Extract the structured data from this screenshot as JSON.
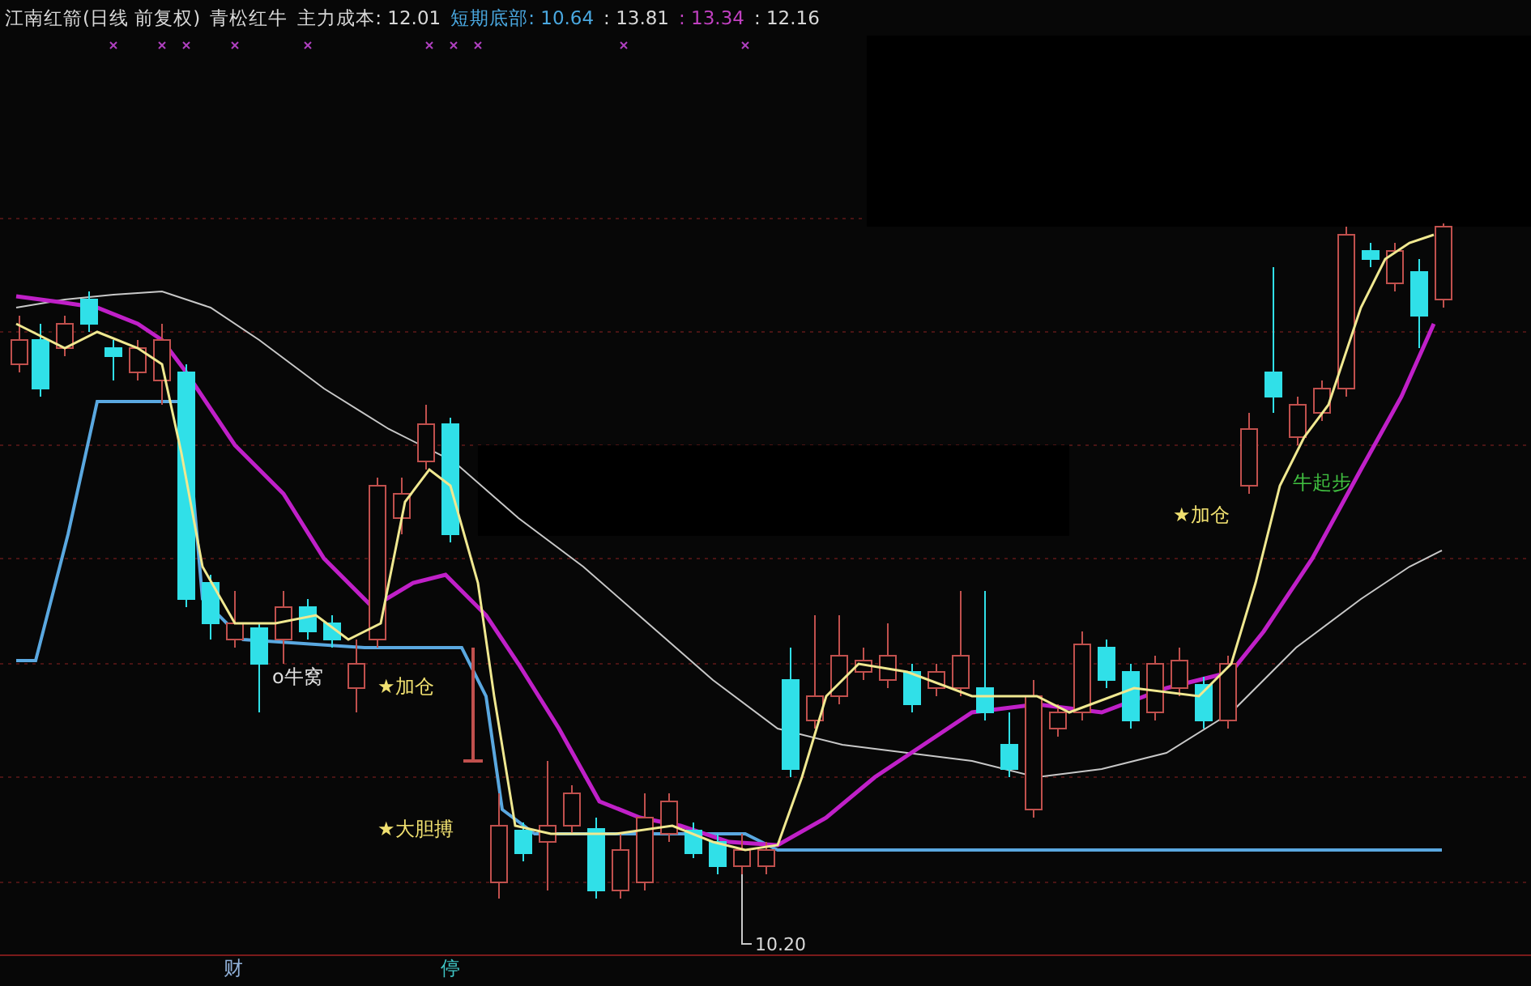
{
  "header": {
    "title": "江南红箭(日线 前复权)",
    "indicator": "青松红牛",
    "items": [
      {
        "text": "主力成本: 12.01",
        "color": "#d8d8d8"
      },
      {
        "text": "短期底部: 10.64",
        "color": "#4aa8e0"
      },
      {
        "text": ": 13.81",
        "color": "#d8d8d8"
      },
      {
        "text": ": 13.34",
        "color": "#c040c0"
      },
      {
        "text": ": 12.16",
        "color": "#d8d8d8"
      }
    ]
  },
  "chart": {
    "annotations": [
      {
        "text": "o牛窝",
        "color": "#e0e0e0"
      },
      {
        "text": "★加仓",
        "color": "#f0e070"
      },
      {
        "text": "★大胆搏",
        "color": "#f0e070"
      },
      {
        "text": "★加仓",
        "color": "#f0e070"
      },
      {
        "text": "牛起步",
        "color": "#40c040"
      }
    ],
    "low_label": "10.20",
    "axis_labels": [
      {
        "text": "财",
        "color": "#90b0d8"
      },
      {
        "text": "停",
        "color": "#40c8c8"
      }
    ]
  }
}
